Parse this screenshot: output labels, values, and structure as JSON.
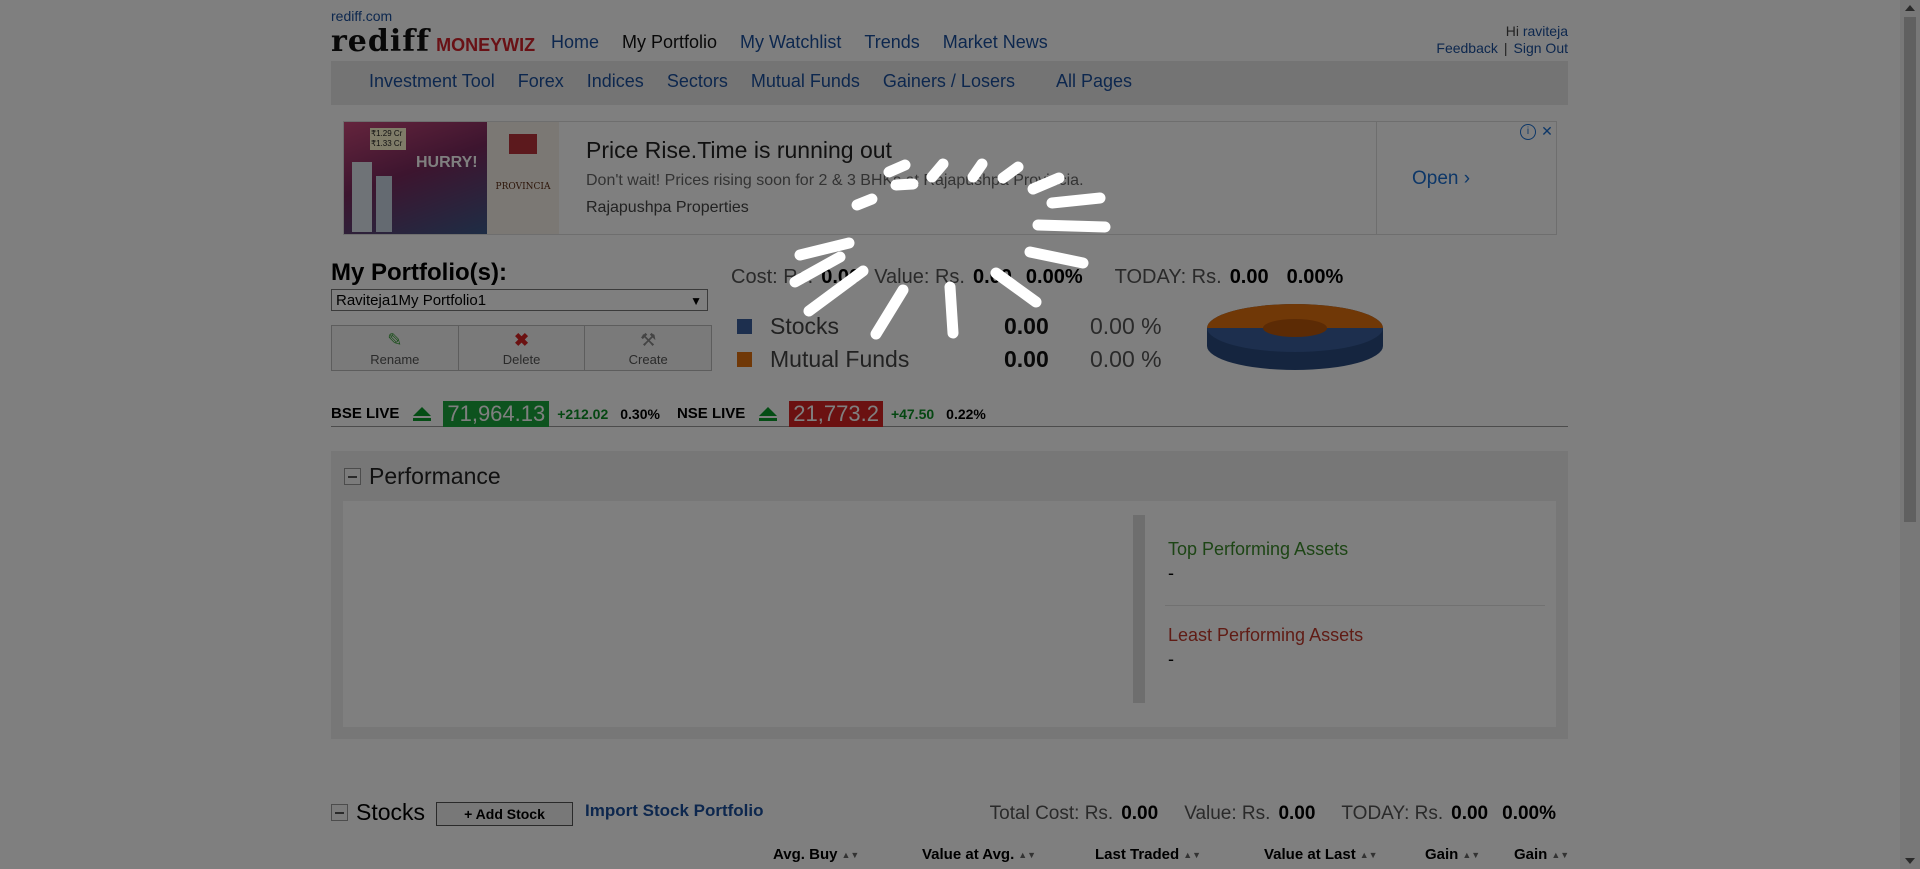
{
  "header": {
    "site": "rediff.com",
    "logo_main": "rediff",
    "logo_sub": "MONEYWIZ",
    "nav": [
      "Home",
      "My Portfolio",
      "My Watchlist",
      "Trends",
      "Market News"
    ],
    "greeting": "Hi",
    "username": "raviteja",
    "feedback": "Feedback",
    "separator": "|",
    "signout": "Sign Out"
  },
  "subnav": [
    "Investment Tool",
    "Forex",
    "Indices",
    "Sectors",
    "Mutual Funds",
    "Gainers / Losers",
    "All Pages"
  ],
  "ad": {
    "title": "Price Rise.Time is running out",
    "description": "Don't wait! Prices rising soon for 2 & 3 BHKs at Rajapushpa Provincia.",
    "advertiser": "Rajapushpa Properties",
    "cta": "Open",
    "img_price_1": "₹1.29 Cr",
    "img_price_2": "₹1.33 Cr",
    "img_hurry": "HURRY!",
    "brand_name": "PROVINCIA",
    "info_icon": "info-icon",
    "close_icon": "close-icon"
  },
  "portfolio": {
    "title": "My Portfolio(s):",
    "selected": "Raviteja1My Portfolio1",
    "buttons": {
      "rename": "Rename",
      "delete": "Delete",
      "create": "Create"
    },
    "cost_label": "Cost: Rs.",
    "cost_value": "0.00",
    "value_label": "Value: Rs.",
    "value_value": "0.00",
    "value_pct": "0.00%",
    "today_label": "TODAY: Rs.",
    "today_value": "0.00",
    "today_pct": "0.00%",
    "legend": [
      {
        "name": "Stocks",
        "value": "0.00",
        "pct": "0.00 %",
        "color": "#3a5f9c"
      },
      {
        "name": "Mutual Funds",
        "value": "0.00",
        "pct": "0.00 %",
        "color": "#e0700f"
      }
    ]
  },
  "ticker": {
    "bse_label": "BSE LIVE",
    "bse_value": "71,964.13",
    "bse_change": "+212.02",
    "bse_pct": "0.30%",
    "nse_label": "NSE LIVE",
    "nse_value": "21,773.2",
    "nse_change": "+47.50",
    "nse_pct": "0.22%"
  },
  "performance": {
    "title": "Performance",
    "top_label": "Top Performing Assets",
    "top_value": "-",
    "least_label": "Least Performing Assets",
    "least_value": "-"
  },
  "stocks": {
    "title": "Stocks",
    "add_button": "+ Add Stock",
    "import_link": "Import Stock Portfolio",
    "total_cost_label": "Total Cost: Rs.",
    "total_cost_value": "0.00",
    "value_label": "Value: Rs.",
    "value_value": "0.00",
    "today_label": "TODAY: Rs.",
    "today_value": "0.00",
    "today_pct": "0.00%",
    "columns": [
      "Avg. Buy",
      "Value at Avg.",
      "Last Traded",
      "Value at Last",
      "Gain",
      "Gain"
    ]
  },
  "colors": {
    "link": "#1a4f9c",
    "up": "#1aa63c",
    "down": "#d62222",
    "logo_red": "#d2232a"
  },
  "overlay": {
    "state": "loading",
    "icon": "loading-spinner-icon"
  }
}
